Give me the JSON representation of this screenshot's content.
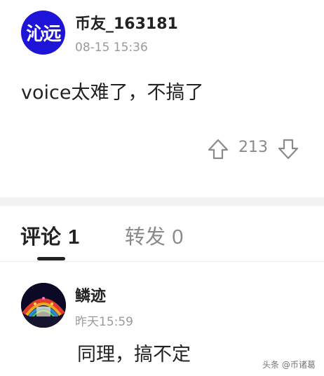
{
  "post": {
    "avatar_text": "沁远",
    "author": "币友_163181",
    "time": "08-15 15:36",
    "text": "voice太难了，不搞了",
    "vote_count": "213"
  },
  "tabs": {
    "comments_label": "评论",
    "comments_count": "1",
    "reposts_label": "转发",
    "reposts_count": "0"
  },
  "comment": {
    "author": "鳞迹",
    "time": "昨天15:59",
    "text": "同理，搞不定"
  },
  "watermark": "头条 @币诸葛",
  "colors": {
    "avatar_bg": "#1e14d8",
    "muted": "#9a9a9a"
  }
}
